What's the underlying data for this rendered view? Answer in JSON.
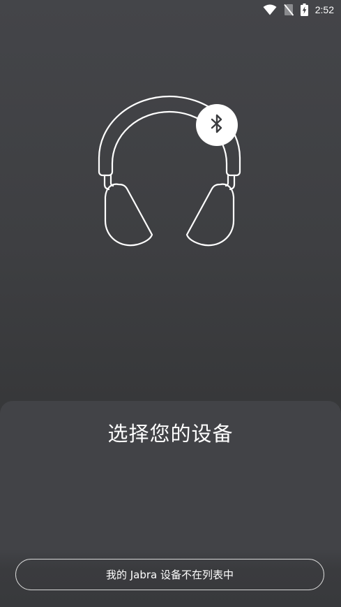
{
  "status_bar": {
    "time": "2:52",
    "icons": [
      "wifi-icon",
      "no-sim-icon",
      "battery-charging-icon"
    ]
  },
  "hero": {
    "image": "headphones-icon",
    "badge_icon": "bluetooth-icon"
  },
  "sheet": {
    "title": "选择您的设备"
  },
  "footer": {
    "not_listed_label": "我的 Jabra 设备不在列表中"
  },
  "colors": {
    "background_top": "#444549",
    "background_bottom": "#333436",
    "sheet": "#424347",
    "text": "#ffffff",
    "button_border": "#d8d8d8"
  }
}
